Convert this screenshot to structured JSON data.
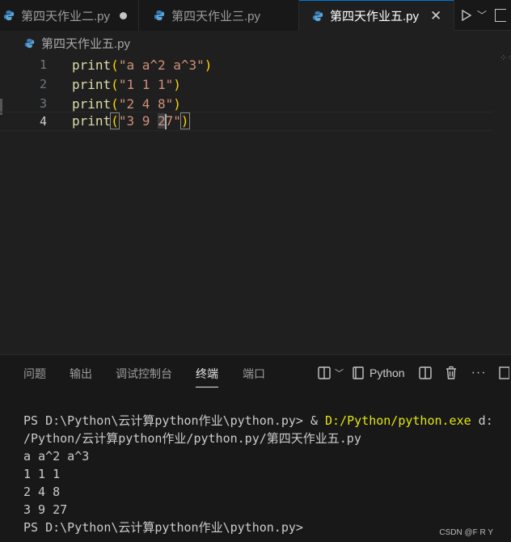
{
  "tabs": [
    {
      "label": "第四天作业二.py",
      "modified": true
    },
    {
      "label": "第四天作业三.py"
    },
    {
      "label": "第四天作业五.py",
      "active": true
    }
  ],
  "breadcrumb": "第四天作业五.py",
  "editor": {
    "lines": [
      {
        "num": "1",
        "fn": "print",
        "str": "\"a a^2 a^3\""
      },
      {
        "num": "2",
        "fn": "print",
        "str": "\"1 1 1\""
      },
      {
        "num": "3",
        "fn": "print",
        "str": "\"2 4 8\""
      },
      {
        "num": "4",
        "fn": "print",
        "str_a": "\"3 9 ",
        "str_b": "2",
        "str_c": "7\""
      }
    ]
  },
  "panel": {
    "tabs": [
      "问题",
      "输出",
      "调试控制台",
      "终端",
      "端口"
    ],
    "active_tab": "终端",
    "shell_label": "Python"
  },
  "terminal": {
    "prompt1": "PS D:\\Python\\云计算python作业\\python.py> & ",
    "cmd": "D:/Python/python.exe",
    "arg1": " d:",
    "arg2": "/Python/云计算python作业/python.py/第四天作业五.py",
    "out1": "a a^2 a^3",
    "out2": "1 1 1",
    "out3": "2 4 8",
    "out4": "3 9 27",
    "prompt2": "PS D:\\Python\\云计算python作业\\python.py>"
  },
  "watermark": "CSDN @F R  Y",
  "colors": {
    "accent": "#0078d4",
    "function": "#dcdcaa",
    "string": "#ce9178",
    "bracket": "#ffd700",
    "terminal_cmd": "#e5e510"
  }
}
